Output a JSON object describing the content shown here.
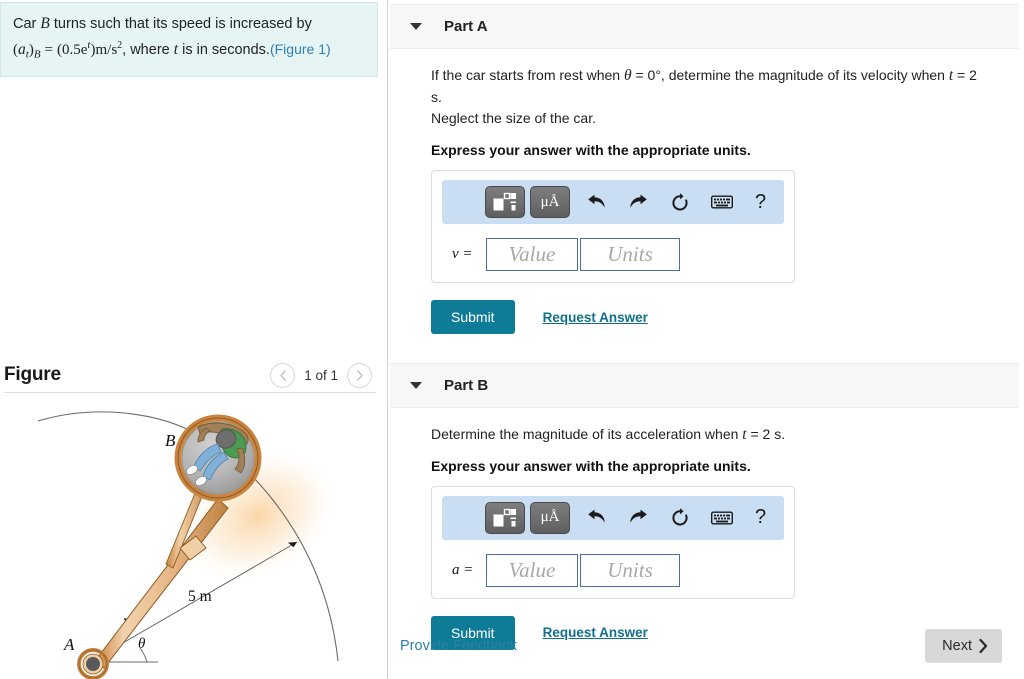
{
  "problem": {
    "line1_pre": "Car ",
    "line1_var": "B",
    "line1_post": " turns such that its speed is increased by",
    "eq_lhs_open": "(",
    "eq_a": "a",
    "eq_t_sub": "t",
    "eq_close_b": ")",
    "eq_B_sub": "B",
    "eq_equals": "=",
    "eq_rhs": "(0.5e",
    "eq_exp": "t",
    "eq_rhs2": ")m/s",
    "eq_sq": "2",
    "line2_post": ", where ",
    "line2_t": "t",
    "line2_post2": " is in seconds.",
    "figure_link": "(Figure 1)"
  },
  "figure": {
    "title": "Figure",
    "prev_icon": "chevron-left-icon",
    "count_label": "1 of 1",
    "next_icon": "chevron-right-icon",
    "labels": {
      "point_a": "A",
      "point_b": "B",
      "radius": "5 m",
      "angle": "θ"
    }
  },
  "parts": [
    {
      "id": "A",
      "header": "Part A",
      "question_pre": "If the car starts from rest when ",
      "question_theta": "θ",
      "question_eq1": " = 0°",
      "question_mid": ", determine the magnitude of its velocity when ",
      "question_t": "t",
      "question_eq2": " = 2 s.",
      "question_tail": "Neglect the size of the car.",
      "instruction": "Express your answer with the appropriate units.",
      "variable": "v =",
      "value_placeholder": "Value",
      "units_placeholder": "Units",
      "value_current": "",
      "units_current": "",
      "submit_label": "Submit",
      "request_label": "Request Answer"
    },
    {
      "id": "B",
      "header": "Part B",
      "question_pre": "Determine the magnitude of its acceleration when ",
      "question_theta": "",
      "question_eq1": "",
      "question_mid": "",
      "question_t": "t",
      "question_eq2": " = 2 s.",
      "question_tail": "",
      "instruction": "Express your answer with the appropriate units.",
      "variable": "a =",
      "value_placeholder": "Value",
      "units_placeholder": "Units",
      "value_current": "",
      "units_current": "",
      "submit_label": "Submit",
      "request_label": "Request Answer"
    }
  ],
  "toolbar": {
    "template_icon": "math-template-icon",
    "units_icon": "micro-angstrom-units-icon",
    "undo_icon": "undo-arrow-icon",
    "redo_icon": "redo-arrow-icon",
    "reset_icon": "reset-circular-arrow-icon",
    "keyboard_icon": "keyboard-icon",
    "help_label": "?"
  },
  "footer": {
    "feedback_label": "Provide Feedback",
    "next_label": "Next",
    "next_icon": "chevron-right-icon"
  },
  "colors": {
    "accent_teal": "#0e7c97",
    "link_blue": "#2b7fa4",
    "problem_bg": "#e6f4f4",
    "toolbar_bg": "#c9ddf3",
    "part_header_bg": "#f7f7f7",
    "input_border": "#4b6ea9",
    "next_btn_bg": "#d8d8d8"
  }
}
